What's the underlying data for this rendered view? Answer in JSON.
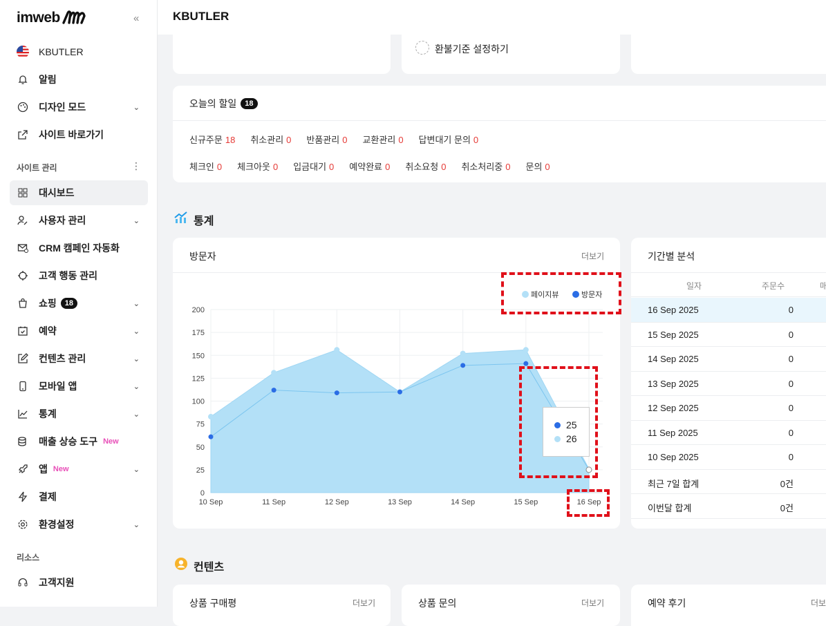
{
  "sidebar": {
    "logo": "imweb",
    "site_name": "KBUTLER",
    "items_top": [
      {
        "label": "알림"
      },
      {
        "label": "디자인 모드"
      },
      {
        "label": "사이트 바로가기"
      }
    ],
    "section_site": "사이트 관리",
    "items_site": [
      {
        "label": "대시보드"
      },
      {
        "label": "사용자 관리"
      },
      {
        "label": "CRM 캠페인 자동화"
      },
      {
        "label": "고객 행동 관리"
      },
      {
        "label": "쇼핑",
        "badge": "18"
      },
      {
        "label": "예약"
      },
      {
        "label": "컨텐츠 관리"
      },
      {
        "label": "모바일 앱"
      },
      {
        "label": "통계"
      },
      {
        "label": "매출 상승 도구",
        "tag": "New"
      },
      {
        "label": "앱",
        "tag": "New"
      },
      {
        "label": "결제"
      },
      {
        "label": "환경설정"
      }
    ],
    "section_resource": "리소스",
    "items_resource": [
      {
        "label": "고객지원"
      }
    ]
  },
  "header": {
    "title": "KBUTLER"
  },
  "top_cards": {
    "refund_label": "환불기준 설정하기"
  },
  "todo": {
    "title": "오늘의 할일",
    "count": "18",
    "row1": [
      {
        "label": "신규주문",
        "value": "18"
      },
      {
        "label": "취소관리",
        "value": "0"
      },
      {
        "label": "반품관리",
        "value": "0"
      },
      {
        "label": "교환관리",
        "value": "0"
      },
      {
        "label": "답변대기 문의",
        "value": "0"
      }
    ],
    "row2": [
      {
        "label": "체크인",
        "value": "0"
      },
      {
        "label": "체크아웃",
        "value": "0"
      },
      {
        "label": "입금대기",
        "value": "0"
      },
      {
        "label": "예약완료",
        "value": "0"
      },
      {
        "label": "취소요청",
        "value": "0"
      },
      {
        "label": "취소처리중",
        "value": "0"
      },
      {
        "label": "문의",
        "value": "0"
      }
    ]
  },
  "stats": {
    "section_title": "통계",
    "visitors_card": {
      "title": "방문자",
      "more": "더보기"
    },
    "period_card": {
      "title": "기간별 분석",
      "columns": [
        "일자",
        "주문수",
        "매"
      ],
      "rows": [
        {
          "date": "16 Sep 2025",
          "orders": "0"
        },
        {
          "date": "15 Sep 2025",
          "orders": "0"
        },
        {
          "date": "14 Sep 2025",
          "orders": "0"
        },
        {
          "date": "13 Sep 2025",
          "orders": "0"
        },
        {
          "date": "12 Sep 2025",
          "orders": "0"
        },
        {
          "date": "11 Sep 2025",
          "orders": "0"
        },
        {
          "date": "10 Sep 2025",
          "orders": "0"
        },
        {
          "date": "최근 7일 합계",
          "orders": "0건"
        },
        {
          "date": "이번달 합계",
          "orders": "0건"
        }
      ]
    },
    "tooltip": {
      "visitors": "25",
      "pageviews": "26"
    }
  },
  "chart_data": {
    "type": "area",
    "categories": [
      "10 Sep",
      "11 Sep",
      "12 Sep",
      "13 Sep",
      "14 Sep",
      "15 Sep",
      "16 Sep"
    ],
    "series": [
      {
        "name": "페이지뷰",
        "values": [
          83,
          131,
          156,
          110,
          152,
          156,
          26
        ],
        "color": "#b3e0f7"
      },
      {
        "name": "방문자",
        "values": [
          61,
          112,
          109,
          110,
          139,
          141,
          25
        ],
        "color": "#2b6de5"
      }
    ],
    "ylim": [
      0,
      200
    ],
    "yticks": [
      0,
      25,
      50,
      75,
      100,
      125,
      150,
      175,
      200
    ],
    "grid": true,
    "legend": "top-right"
  },
  "contents": {
    "section_title": "컨텐츠",
    "cards": [
      {
        "title": "상품 구매평",
        "more": "더보기"
      },
      {
        "title": "상품 문의",
        "more": "더보기"
      },
      {
        "title": "예약 후기",
        "more": "더보"
      }
    ]
  }
}
